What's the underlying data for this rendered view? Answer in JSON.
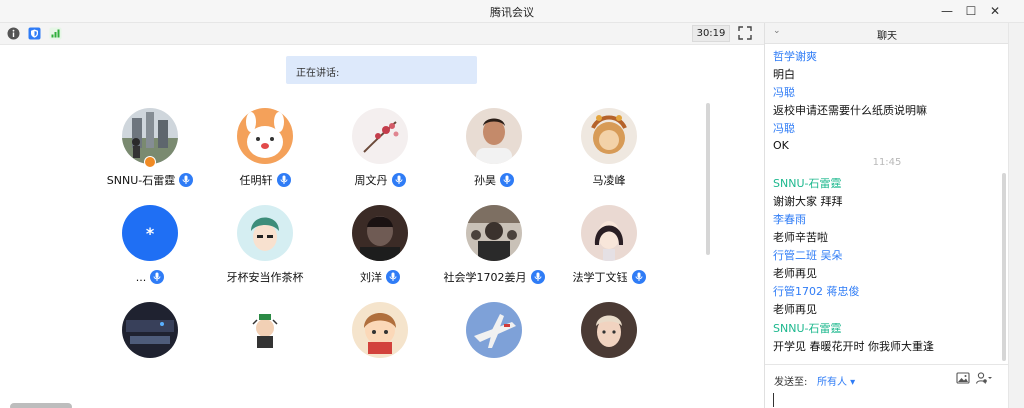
{
  "window": {
    "title": "腾讯会议",
    "minimize_glyph": "—",
    "maximize_glyph": "☐",
    "close_glyph": "✕"
  },
  "toolbar": {
    "icons": [
      "info-icon",
      "shield-icon",
      "signal-icon"
    ],
    "timer": "30:19"
  },
  "speaking": {
    "label": "正在讲话:"
  },
  "participants": [
    {
      "name": "SNNU-石雷霆",
      "mic": true,
      "host": true
    },
    {
      "name": "任明轩",
      "mic": true
    },
    {
      "name": "周文丹",
      "mic": true
    },
    {
      "name": "孙昊",
      "mic": true
    },
    {
      "name": "马凌峰",
      "mic": false
    },
    {
      "name": "...",
      "mic": true,
      "avatar_text": "*"
    },
    {
      "name": "牙杯安当作茶杯",
      "mic": false
    },
    {
      "name": "刘洋",
      "mic": true
    },
    {
      "name": "社会学1702姜月",
      "mic": true
    },
    {
      "name": "法学丁文钰",
      "mic": true
    },
    {
      "name": "",
      "mic": false
    },
    {
      "name": "",
      "mic": false
    },
    {
      "name": "",
      "mic": false
    },
    {
      "name": "",
      "mic": false
    },
    {
      "name": "",
      "mic": false
    }
  ],
  "chat": {
    "title": "聊天",
    "collapse_glyph": "⌄",
    "messages": [
      {
        "kind": "sender",
        "text": "哲学谢爽"
      },
      {
        "kind": "text",
        "text": "明白"
      },
      {
        "kind": "sender",
        "text": "冯聪"
      },
      {
        "kind": "text",
        "text": "返校申请还需要什么纸质说明嘛"
      },
      {
        "kind": "sender",
        "text": "冯聪"
      },
      {
        "kind": "text",
        "text": "OK"
      },
      {
        "kind": "time",
        "text": "11:45"
      },
      {
        "kind": "host",
        "text": "SNNU-石雷霆"
      },
      {
        "kind": "text",
        "text": "谢谢大家 拜拜"
      },
      {
        "kind": "sender",
        "text": "李春雨"
      },
      {
        "kind": "text",
        "text": "老师辛苦啦"
      },
      {
        "kind": "sender",
        "text": "行管二班 吴朵"
      },
      {
        "kind": "text",
        "text": "老师再见"
      },
      {
        "kind": "sender",
        "text": "行管1702 蒋忠俊"
      },
      {
        "kind": "text",
        "text": "老师再见"
      },
      {
        "kind": "host",
        "text": "SNNU-石雷霆"
      },
      {
        "kind": "text",
        "text": "开学见 春暖花开时 你我师大重逢"
      }
    ],
    "send_to_label": "发送至:",
    "recipient": "所有人 ▾",
    "input_value": ""
  },
  "colors": {
    "accent": "#2f7cf6",
    "host": "#1db88e",
    "speaking_bg": "#dde9fb",
    "host_badge": "#f08a24"
  }
}
